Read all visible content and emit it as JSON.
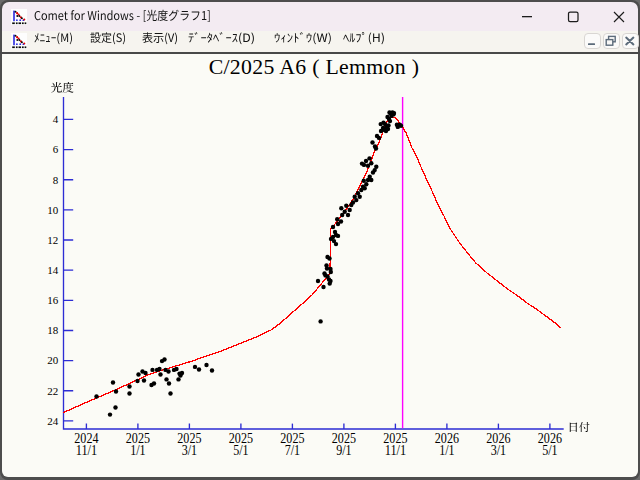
{
  "window": {
    "title": "Comet for Windows - [光度グラフ1]",
    "controls": [
      {
        "name": "minimize"
      },
      {
        "name": "maximize"
      },
      {
        "name": "close"
      }
    ]
  },
  "menubar": {
    "items": [
      {
        "label": "ﾒﾆｭｰ(M)",
        "mnemonic": "M"
      },
      {
        "label": "設定(S)",
        "mnemonic": "S"
      },
      {
        "label": "表示(V)",
        "mnemonic": "V"
      },
      {
        "label": "ﾃﾞｰﾀﾍﾞｰｽ(D)",
        "mnemonic": "D"
      },
      {
        "label": "ｳｨﾝﾄﾞｳ(W)",
        "mnemonic": "W"
      },
      {
        "label": "ﾍﾙﾌﾟ(H)",
        "mnemonic": "H"
      }
    ],
    "mdi_controls": [
      {
        "name": "minimize"
      },
      {
        "name": "restore"
      },
      {
        "name": "close"
      }
    ]
  },
  "chart_data": {
    "type": "scatter",
    "title": "C/2025 A6 ( Lemmon )",
    "xlabel": "日付",
    "ylabel": "光度",
    "x_unit": "ticks of 2 months starting 2024-11-01",
    "y_unit": "magnitude (brighter = up)",
    "x_axis": {
      "ticks": [
        0,
        1,
        2,
        3,
        4,
        5,
        6,
        7,
        8,
        9
      ],
      "tick_labels": [
        [
          "2024",
          "11/1"
        ],
        [
          "2025",
          "1/1"
        ],
        [
          "2025",
          "3/1"
        ],
        [
          "2025",
          "5/1"
        ],
        [
          "2025",
          "7/1"
        ],
        [
          "2025",
          "9/1"
        ],
        [
          "2025",
          "11/1"
        ],
        [
          "2026",
          "1/1"
        ],
        [
          "2026",
          "3/1"
        ],
        [
          "2026",
          "5/1"
        ]
      ]
    },
    "y_axis": {
      "ticks": [
        4,
        6,
        8,
        10,
        12,
        14,
        16,
        18,
        20,
        22,
        24
      ],
      "inverted": true
    },
    "event_line": {
      "t": 6.14,
      "color": "#ff00ff"
    },
    "grid": false,
    "legend": false,
    "series": [
      {
        "name": "predicted light curve",
        "type": "line",
        "color": "#ff0000",
        "points": [
          [
            -0.445,
            23.44
          ],
          [
            -0.008,
            22.78
          ],
          [
            0.458,
            22.1
          ],
          [
            0.866,
            21.47
          ],
          [
            1.235,
            20.89
          ],
          [
            1.643,
            20.46
          ],
          [
            2.05,
            20.03
          ],
          [
            2.322,
            19.71
          ],
          [
            2.594,
            19.4
          ],
          [
            2.983,
            18.87
          ],
          [
            3.371,
            18.33
          ],
          [
            3.584,
            17.97
          ],
          [
            3.759,
            17.54
          ],
          [
            3.953,
            16.94
          ],
          [
            4.109,
            16.48
          ],
          [
            4.264,
            16.01
          ],
          [
            4.381,
            15.65
          ],
          [
            4.497,
            15.18
          ],
          [
            4.594,
            14.77
          ],
          [
            4.664,
            14.52
          ],
          [
            4.718,
            14.24
          ],
          [
            4.732,
            14.24
          ],
          [
            4.738,
            11.31
          ],
          [
            4.769,
            11.17
          ],
          [
            4.827,
            10.94
          ],
          [
            4.866,
            10.77
          ],
          [
            4.944,
            10.44
          ],
          [
            5.002,
            10.14
          ],
          [
            5.118,
            9.63
          ],
          [
            5.196,
            9.18
          ],
          [
            5.274,
            8.68
          ],
          [
            5.332,
            8.25
          ],
          [
            5.39,
            7.85
          ],
          [
            5.468,
            7.29
          ],
          [
            5.526,
            6.76
          ],
          [
            5.584,
            6.18
          ],
          [
            5.67,
            5.63
          ],
          [
            5.72,
            5.2
          ],
          [
            5.779,
            4.55
          ],
          [
            5.827,
            4.21
          ],
          [
            5.866,
            4.01
          ],
          [
            5.905,
            3.88
          ],
          [
            5.992,
            3.87
          ],
          [
            6.041,
            4.04
          ],
          [
            6.089,
            4.27
          ],
          [
            6.138,
            4.49
          ],
          [
            6.202,
            4.87
          ],
          [
            6.264,
            5.37
          ],
          [
            6.322,
            5.9
          ],
          [
            6.414,
            6.49
          ],
          [
            6.497,
            7.16
          ],
          [
            6.623,
            8.11
          ],
          [
            6.711,
            8.75
          ],
          [
            6.835,
            9.72
          ],
          [
            6.944,
            10.41
          ],
          [
            7.045,
            11.16
          ],
          [
            7.157,
            11.73
          ],
          [
            7.254,
            12.24
          ],
          [
            7.371,
            12.73
          ],
          [
            7.466,
            13.14
          ],
          [
            7.565,
            13.53
          ],
          [
            7.676,
            13.86
          ],
          [
            7.779,
            14.19
          ],
          [
            7.885,
            14.47
          ],
          [
            7.992,
            14.75
          ],
          [
            8.097,
            15.04
          ],
          [
            8.206,
            15.32
          ],
          [
            8.307,
            15.55
          ],
          [
            8.419,
            15.81
          ],
          [
            8.518,
            16.09
          ],
          [
            8.614,
            16.31
          ],
          [
            8.728,
            16.56
          ],
          [
            8.827,
            16.81
          ],
          [
            8.938,
            17.09
          ],
          [
            9.041,
            17.34
          ],
          [
            9.15,
            17.63
          ],
          [
            9.216,
            17.84
          ]
        ]
      },
      {
        "name": "observations",
        "type": "scatter",
        "color": "#000000",
        "points": [
          [
            0.196,
            22.38
          ],
          [
            0.458,
            23.58
          ],
          [
            0.565,
            23.11
          ],
          [
            0.517,
            21.45
          ],
          [
            0.575,
            22.05
          ],
          [
            0.837,
            21.72
          ],
          [
            0.837,
            22.18
          ],
          [
            0.992,
            21.35
          ],
          [
            1.012,
            20.92
          ],
          [
            1.089,
            20.72
          ],
          [
            1.118,
            21.32
          ],
          [
            1.148,
            20.82
          ],
          [
            1.264,
            21.62
          ],
          [
            1.283,
            20.62
          ],
          [
            1.313,
            21.52
          ],
          [
            1.371,
            20.62
          ],
          [
            1.419,
            20.56
          ],
          [
            1.439,
            20.92
          ],
          [
            1.468,
            20.03
          ],
          [
            1.517,
            19.93
          ],
          [
            1.536,
            20.62
          ],
          [
            1.555,
            21.25
          ],
          [
            1.594,
            20.72
          ],
          [
            1.604,
            21.52
          ],
          [
            1.633,
            22.18
          ],
          [
            1.701,
            20.62
          ],
          [
            1.75,
            20.56
          ],
          [
            1.788,
            21.25
          ],
          [
            1.808,
            20.86
          ],
          [
            1.827,
            20.99
          ],
          [
            1.856,
            20.82
          ],
          [
            2.109,
            20.42
          ],
          [
            2.186,
            20.59
          ],
          [
            2.332,
            20.29
          ],
          [
            2.439,
            20.66
          ],
          [
            4.548,
            17.4
          ],
          [
            4.682,
            13.13
          ],
          [
            4.72,
            13.23
          ],
          [
            4.662,
            13.69
          ],
          [
            4.74,
            13.92
          ],
          [
            4.746,
            14.12
          ],
          [
            4.672,
            13.89
          ],
          [
            4.643,
            14.35
          ],
          [
            4.682,
            14.42
          ],
          [
            4.623,
            14.22
          ],
          [
            4.711,
            14.62
          ],
          [
            4.74,
            14.72
          ],
          [
            4.724,
            14.89
          ],
          [
            4.497,
            14.72
          ],
          [
            4.604,
            15.12
          ],
          [
            4.788,
            11.14
          ],
          [
            4.827,
            11.47
          ],
          [
            4.885,
            11.73
          ],
          [
            4.808,
            12.07
          ],
          [
            4.847,
            12.27
          ],
          [
            4.75,
            11.93
          ],
          [
            4.788,
            11.8
          ],
          [
            4.847,
            11.67
          ],
          [
            4.885,
            10.94
          ],
          [
            4.944,
            10.77
          ],
          [
            4.87,
            10.62
          ],
          [
            4.967,
            10.34
          ],
          [
            5.016,
            10.12
          ],
          [
            4.95,
            9.9
          ],
          [
            5.08,
            10.34
          ],
          [
            5.047,
            9.73
          ],
          [
            5.113,
            10.01
          ],
          [
            5.144,
            9.68
          ],
          [
            5.177,
            9.51
          ],
          [
            5.241,
            9.35
          ],
          [
            5.21,
            9.13
          ],
          [
            5.274,
            8.9
          ],
          [
            5.307,
            9.13
          ],
          [
            5.338,
            8.68
          ],
          [
            5.371,
            8.46
          ],
          [
            5.404,
            8.57
          ],
          [
            5.435,
            8.3
          ],
          [
            5.386,
            8.07
          ],
          [
            5.468,
            8.02
          ],
          [
            5.501,
            7.8
          ],
          [
            5.532,
            8.02
          ],
          [
            5.565,
            7.52
          ],
          [
            5.598,
            7.36
          ],
          [
            5.629,
            7.14
          ],
          [
            5.468,
            7.08
          ],
          [
            5.532,
            6.91
          ],
          [
            5.429,
            6.76
          ],
          [
            5.351,
            6.93
          ],
          [
            5.39,
            7.02
          ],
          [
            5.497,
            6.59
          ],
          [
            5.555,
            5.53
          ],
          [
            5.604,
            5.8
          ],
          [
            5.623,
            5.93
          ],
          [
            5.643,
            5.1
          ],
          [
            5.682,
            5.23
          ],
          [
            5.715,
            4.31
          ],
          [
            5.769,
            4.21
          ],
          [
            5.798,
            4.31
          ],
          [
            5.759,
            4.57
          ],
          [
            5.72,
            4.77
          ],
          [
            5.788,
            4.7
          ],
          [
            5.827,
            4.5
          ],
          [
            5.847,
            3.84
          ],
          [
            5.876,
            3.97
          ],
          [
            5.905,
            3.61
          ],
          [
            5.924,
            3.77
          ],
          [
            5.944,
            3.54
          ],
          [
            5.885,
            3.54
          ],
          [
            5.963,
            3.67
          ],
          [
            5.973,
            3.58
          ],
          [
            5.856,
            4.64
          ],
          [
            5.817,
            4.77
          ],
          [
            5.866,
            4.4
          ],
          [
            5.895,
            4.11
          ],
          [
            6.029,
            4.35
          ],
          [
            6.047,
            4.5
          ],
          [
            6.085,
            4.36
          ],
          [
            6.109,
            4.42
          ]
        ]
      }
    ]
  },
  "colors": {
    "axis": "#2d2dd4",
    "curve": "#ff0000",
    "event_line": "#ff00ff",
    "points": "#000000",
    "titlebar_bg": "#f3ebf2",
    "menubar_bg": "#f6f4ef",
    "client_bg": "#fbfbf6",
    "frame": "#4d4d4d"
  }
}
